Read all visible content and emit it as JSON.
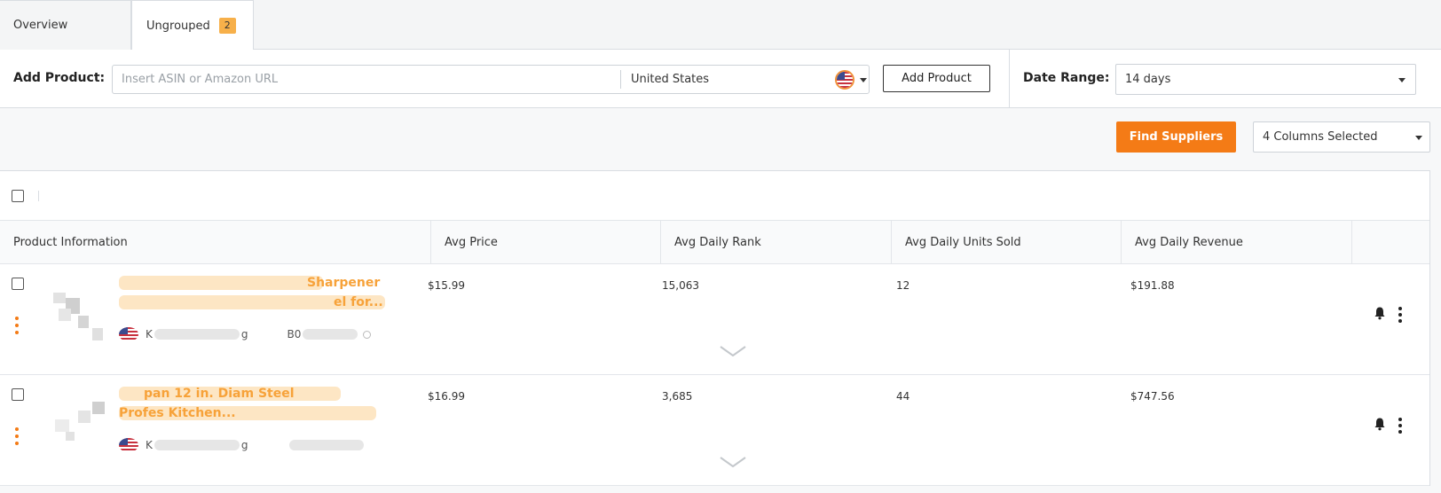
{
  "tabs": [
    {
      "label": "Overview"
    },
    {
      "label": "Ungrouped",
      "badge": "2"
    }
  ],
  "add_product": {
    "label": "Add Product:",
    "placeholder": "Insert ASIN or Amazon URL",
    "country": "United States",
    "flag_icon": "us-flag-icon",
    "button_label": "Add Product"
  },
  "date_range": {
    "label": "Date Range:",
    "value": "14 days"
  },
  "actions": {
    "find_suppliers": "Find Suppliers",
    "columns_selected": "4 Columns Selected"
  },
  "colors": {
    "accent": "#f47b16",
    "title_link": "#f7a239",
    "badge": "#f7b04a"
  },
  "table": {
    "headers": [
      "Product Information",
      "Avg Price",
      "Avg Daily Rank",
      "Avg Daily Units Sold",
      "Avg Daily Revenue"
    ],
    "rows": [
      {
        "title_line1": "Sharpener",
        "title_line2": "el for...",
        "seller_prefix": "K",
        "seller_suffix": "g",
        "asin_prefix": "B0",
        "price": "$15.99",
        "rank": "15,063",
        "units": "12",
        "revenue": "$191.88"
      },
      {
        "title_line1": "pan 12 in. Diam  Steel",
        "title_line2": "Profes  Kitchen...",
        "seller_prefix": "K",
        "seller_suffix": "g",
        "asin_prefix": "",
        "price": "$16.99",
        "rank": "3,685",
        "units": "44",
        "revenue": "$747.56"
      }
    ]
  }
}
